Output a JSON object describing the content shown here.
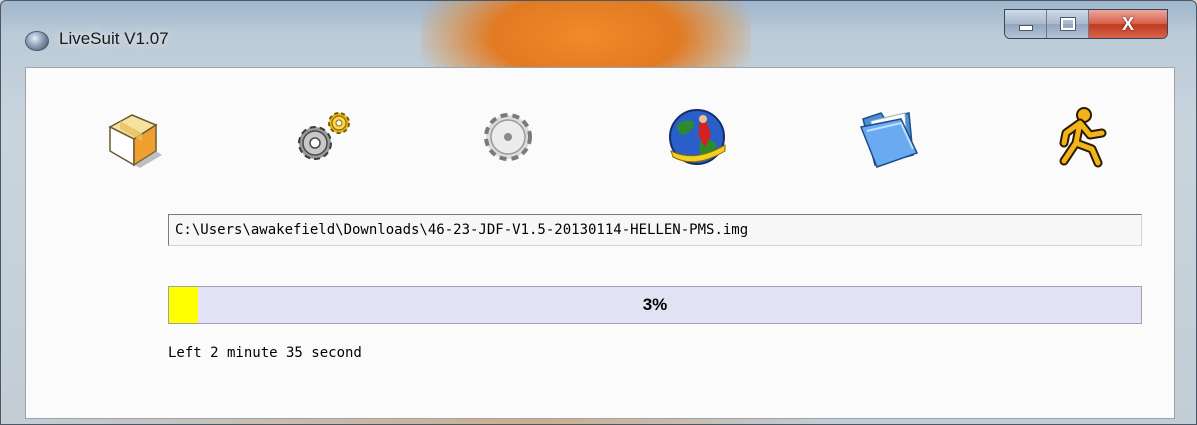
{
  "window": {
    "title": "LiveSuit V1.07",
    "app_icon": "livesuit-icon",
    "controls": {
      "minimize": "minimize-icon",
      "maximize": "maximize-icon",
      "close": "X"
    }
  },
  "toolbar": [
    {
      "name": "toolbar-button-package",
      "icon": "package-box-icon"
    },
    {
      "name": "toolbar-button-settings",
      "icon": "gears-icon"
    },
    {
      "name": "toolbar-button-gear",
      "icon": "gear-icon"
    },
    {
      "name": "toolbar-button-web",
      "icon": "globe-surfer-icon"
    },
    {
      "name": "toolbar-button-open-folder",
      "icon": "folder-icon"
    },
    {
      "name": "toolbar-button-run",
      "icon": "running-man-icon"
    }
  ],
  "image_path": "C:\\Users\\awakefield\\Downloads\\46-23-JDF-V1.5-20130114-HELLEN-PMS.img",
  "progress": {
    "percent": 3,
    "label": "3%",
    "fill_color": "#ffff00",
    "track_color": "#e2e2f4"
  },
  "status": "Left 2 minute 35 second"
}
